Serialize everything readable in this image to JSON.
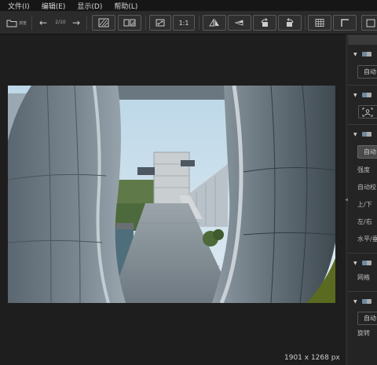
{
  "menu": {
    "items": [
      {
        "label": "文件(I)"
      },
      {
        "label": "编辑(E)"
      },
      {
        "label": "显示(D)"
      },
      {
        "label": "帮助(L)"
      }
    ]
  },
  "toolbar": {
    "folder_label": "浏览",
    "prev_symbol": "←",
    "next_symbol": "→",
    "page_indicator": "2/10",
    "zoom_label": "1:1"
  },
  "canvas": {
    "dimensions": "1901 x 1268 px"
  },
  "panel": {
    "grip_symbol": "◀",
    "auto_label_1": "自动",
    "auto_label_2": "自动",
    "auto_label_3": "自动",
    "strength_label": "强度",
    "auto_correct_label": "自动校",
    "up_down_label": "上/下",
    "left_right_label": "左/右",
    "horizontal_label": "水平/垂",
    "grid_label": "网格",
    "rotate_label": "旋转"
  }
}
